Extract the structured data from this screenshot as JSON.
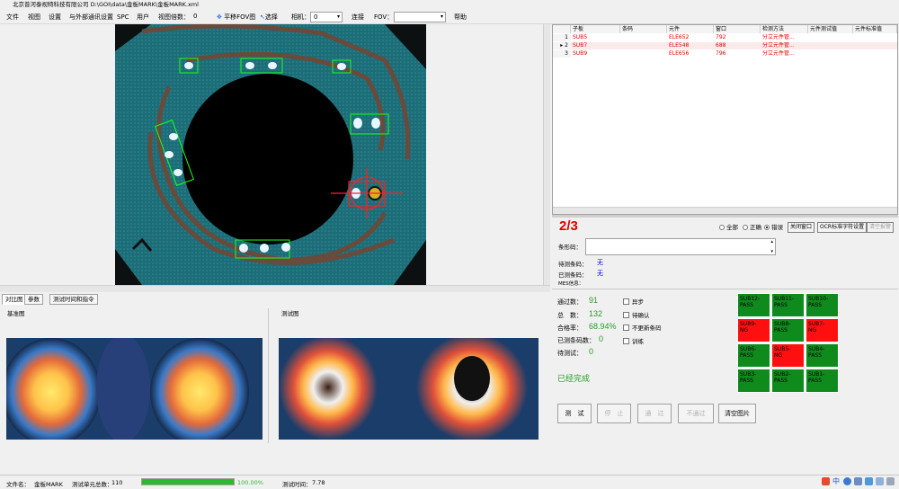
{
  "window": {
    "title": "北京普河泰视特科技有限公司   D:\\GOI\\data\\金板MARK\\金板MARK.xml"
  },
  "menu": {
    "file": "文件",
    "view": "视图",
    "settings": "设置",
    "comm": "与外部通讯设置",
    "spc": "SPC",
    "user": "用户",
    "view_count_label": "视图倍数：",
    "view_count_value": "0",
    "pan_fov": "平移FOV图",
    "select": "选择",
    "camera_label": "相机：",
    "camera_value": "0",
    "connect": "连接",
    "fov_label": "FOV：",
    "fov_value": "",
    "help": "帮助"
  },
  "tabs": {
    "compare": "对比图",
    "params": "参数",
    "time_cmd": "测试时间和指令"
  },
  "panels": {
    "base": "基准图",
    "test": "测试图"
  },
  "table": {
    "headers": [
      "子板",
      "条码",
      "元件",
      "窗口",
      "检测方法",
      "元件测试值",
      "元件标准值"
    ],
    "rows": [
      {
        "num": "1",
        "sub": "SUB5",
        "barcode": "",
        "part": "ELE652",
        "window": "792",
        "method": "分立元件管..."
      },
      {
        "num": "2",
        "sub": "SUB7",
        "barcode": "",
        "part": "ELE548",
        "window": "688",
        "method": "分立元件管..."
      },
      {
        "num": "3",
        "sub": "SUB9",
        "barcode": "",
        "part": "ELE656",
        "window": "796",
        "method": "分立元件管..."
      }
    ]
  },
  "nav": {
    "ratio": "2/3",
    "filter_all": "全部",
    "filter_ok": "正确",
    "filter_err": "错误",
    "close_window": "关闭窗口",
    "ocr_set": "OCR标准字符设置",
    "clear_alarm": "清空报警"
  },
  "info": {
    "barcode_label": "条形码：",
    "pending_label": "待测条码：",
    "pending_value": "无",
    "tested_label": "已测条码：",
    "tested_value": "无",
    "mes_label": "MES信息："
  },
  "stats": {
    "pass_label": "通过数：",
    "pass_value": "91",
    "total_label": "总　数：",
    "total_value": "132",
    "yield_label": "合格率：",
    "yield_value": "68.94%",
    "tested_codes_label": "已测条码数：",
    "tested_codes_value": "0",
    "pending_test_label": "待测试：",
    "pending_test_value": "0",
    "done": "已经完成"
  },
  "checks": {
    "async": "异步",
    "confirm": "待确认",
    "no_update_barcode": "不更新条码",
    "train": "训练"
  },
  "grid": [
    [
      "SUB12-\nPASS",
      "SUB11-\nPASS",
      "SUB10-\nPASS"
    ],
    [
      "SUB9-\nNG",
      "SUB8-\nPASS",
      "SUB7-\nNG"
    ],
    [
      "SUB6-\nPASS",
      "SUB5-\nNG",
      "SUB4-\nPASS"
    ],
    [
      "SUB3-\nPASS",
      "SUB2-\nPASS",
      "SUB1-\nPASS"
    ]
  ],
  "grid_colors": {
    "pass": "#0f8a1d",
    "ng": "#ff1010"
  },
  "buttons": {
    "test": "测　试",
    "stop": "停　止",
    "pass": "通　过",
    "fail": "不通过",
    "clear_img": "清空图片"
  },
  "status": {
    "file_label": "文件名：",
    "file_value": "金板MARK",
    "units_label": "测试单元总数：",
    "units_value": "110",
    "progress_text": "100.00%",
    "progress": 1.0,
    "time_label": "测试时间：",
    "time_value": "7.78"
  }
}
